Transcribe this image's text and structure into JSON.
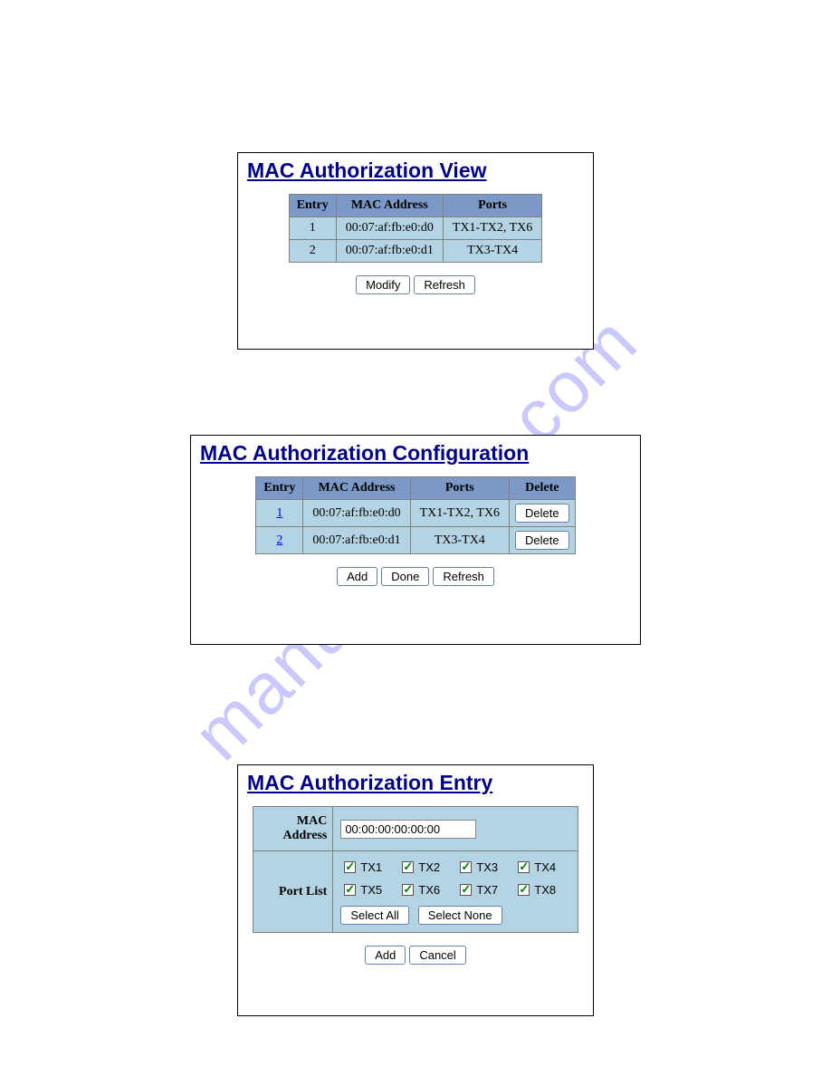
{
  "watermark": "manualshive.com",
  "view": {
    "title": "MAC Authorization View",
    "headers": [
      "Entry",
      "MAC Address",
      "Ports"
    ],
    "rows": [
      {
        "entry": "1",
        "mac": "00:07:af:fb:e0:d0",
        "ports": "TX1-TX2, TX6"
      },
      {
        "entry": "2",
        "mac": "00:07:af:fb:e0:d1",
        "ports": "TX3-TX4"
      }
    ],
    "buttons": {
      "modify": "Modify",
      "refresh": "Refresh"
    }
  },
  "config": {
    "title": "MAC Authorization Configuration",
    "headers": [
      "Entry",
      "MAC Address",
      "Ports",
      "Delete"
    ],
    "rows": [
      {
        "entry": "1",
        "mac": "00:07:af:fb:e0:d0",
        "ports": "TX1-TX2, TX6",
        "delete": "Delete"
      },
      {
        "entry": "2",
        "mac": "00:07:af:fb:e0:d1",
        "ports": "TX3-TX4",
        "delete": "Delete"
      }
    ],
    "buttons": {
      "add": "Add",
      "done": "Done",
      "refresh": "Refresh"
    }
  },
  "entry": {
    "title": "MAC Authorization Entry",
    "mac_label": "MAC Address",
    "mac_value": "00:00:00:00:00:00",
    "portlist_label": "Port List",
    "ports": [
      "TX1",
      "TX2",
      "TX3",
      "TX4",
      "TX5",
      "TX6",
      "TX7",
      "TX8"
    ],
    "select_all": "Select All",
    "select_none": "Select None",
    "buttons": {
      "add": "Add",
      "cancel": "Cancel"
    }
  }
}
